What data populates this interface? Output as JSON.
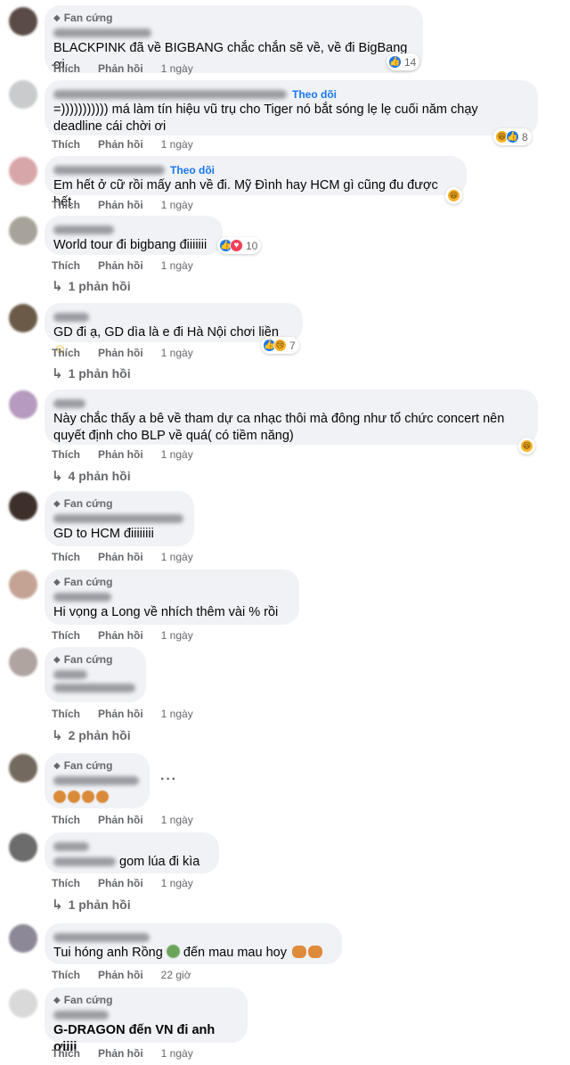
{
  "colors": {
    "bubble": "#f0f2f5",
    "meta": "#65676b",
    "link": "#1877f2",
    "like": "#1877f2",
    "haha": "#f7b125",
    "love": "#f33e58"
  },
  "labels": {
    "like": "Thích",
    "reply": "Phản hồi",
    "fan_badge": "Fan cứng",
    "follow": "Theo dõi"
  },
  "comments": [
    {
      "author": "Nguyễn Hồng Sơn",
      "badge": "Fan cứng",
      "text": "BLACKPINK đã về BIGBANG chắc chắn sẽ về, về đi BigBang ơi",
      "time": "1 ngày",
      "reactions": [
        "like-icon"
      ],
      "reaction_count": "14"
    },
    {
      "author": "",
      "follow": "Theo dõi",
      "text": "=))))))))))) má làm tín hiệu vũ trụ cho Tiger nó bắt sóng lẹ lẹ cuối năm chạy\ndeadline cái chời ơi",
      "time": "1 ngày",
      "reactions": [
        "haha-icon",
        "like-icon"
      ],
      "reaction_count": "8"
    },
    {
      "author": "",
      "follow": "Theo dõi",
      "text": "Em hết ở cữ rồi mấy anh về đi. Mỹ Đình hay HCM gì cũng đu được hết",
      "time": "1 ngày",
      "reactions": [
        "haha-icon"
      ],
      "reaction_count": ""
    },
    {
      "author": "",
      "text": "World tour đi bigbang điiiiiii",
      "time": "1 ngày",
      "reactions": [
        "like-icon",
        "love-icon"
      ],
      "reaction_count": "10",
      "replies": "1 phản hồi"
    },
    {
      "author": "",
      "text": "GD đi ạ, GD dìa là e đi Hà Nội chơi liền",
      "time": "1 ngày",
      "reactions": [
        "like-icon",
        "sad-icon"
      ],
      "reaction_count": "7",
      "replies": "1 phản hồi"
    },
    {
      "author": "",
      "text": "Này chắc thấy a bê về tham dự ca nhạc thôi mà đông như tổ chức concert nên\nquyết định cho BLP về quá( có tiềm năng)",
      "time": "1 ngày",
      "reactions": [
        "haha-icon"
      ],
      "reaction_count": "",
      "replies": "4 phản hồi"
    },
    {
      "author": "",
      "badge": "Fan cứng",
      "text": "GD to HCM điiiiiiii",
      "time": "1 ngày"
    },
    {
      "author": "",
      "badge": "Fan cứng",
      "text": "Hi vọng a Long về nhích thêm vài % rồi",
      "time": "1 ngày"
    },
    {
      "author": "",
      "badge": "Fan cứng",
      "text": "",
      "time": "1 ngày",
      "replies": "2 phản hồi"
    },
    {
      "author": "",
      "badge": "Fan cứng",
      "text": "",
      "time": "1 ngày"
    },
    {
      "author": "",
      "text": "gom lúa đi kìa",
      "time": "1 ngày",
      "replies": "1 phản hồi"
    },
    {
      "author": "",
      "text": "Tui hóng anh Rồng",
      "text2": "đến mau mau hoy",
      "time": "22 giờ"
    },
    {
      "author": "",
      "badge": "Fan cứng",
      "text": "G-DRAGON đến VN đi anh ơiiii",
      "time": "1 ngày"
    }
  ]
}
